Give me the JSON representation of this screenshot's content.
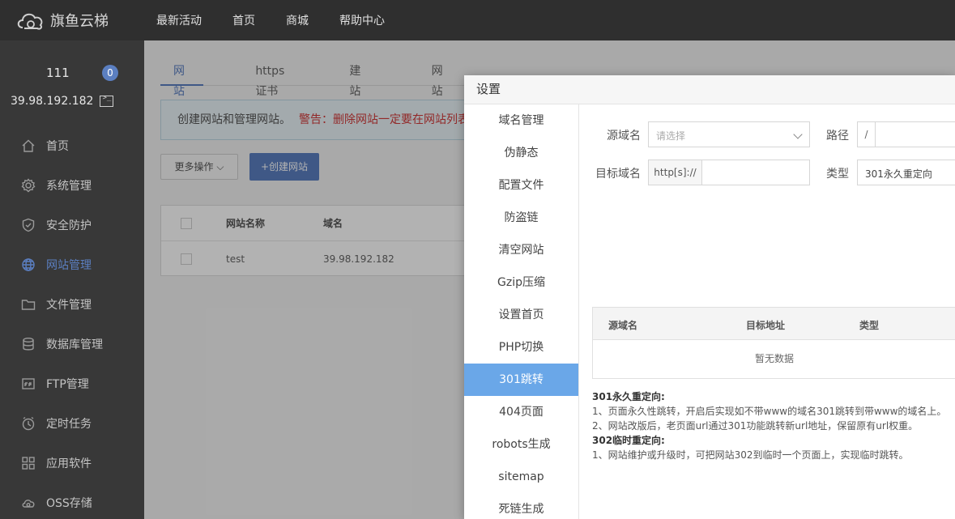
{
  "brand": {
    "name": "旗鱼云梯"
  },
  "topnav": [
    "最新活动",
    "首页",
    "商城",
    "帮助中心"
  ],
  "user": {
    "name": "111",
    "badge": "0",
    "ip": "39.98.192.182"
  },
  "sidebar": {
    "items": [
      {
        "label": "首页",
        "icon": "home-icon"
      },
      {
        "label": "系统管理",
        "icon": "gear-icon"
      },
      {
        "label": "安全防护",
        "icon": "shield-icon"
      },
      {
        "label": "网站管理",
        "icon": "globe-icon",
        "active": true
      },
      {
        "label": "文件管理",
        "icon": "folder-icon"
      },
      {
        "label": "数据库管理",
        "icon": "database-icon"
      },
      {
        "label": "FTP管理",
        "icon": "ftp-icon"
      },
      {
        "label": "定时任务",
        "icon": "clock-icon"
      },
      {
        "label": "应用软件",
        "icon": "apps-icon"
      },
      {
        "label": "OSS存储",
        "icon": "cloud-storage-icon"
      }
    ]
  },
  "main": {
    "tabs": [
      "网站列表",
      "https证书",
      "建站模板",
      "网站日志"
    ],
    "notice": "创建网站和管理网站。",
    "notice_warn": "警告：删除网站一定要在网站列表",
    "more_button": "更多操作 ⌵",
    "create_button": "+创建网站",
    "table": {
      "headers": [
        "网站名称",
        "域名"
      ],
      "rows": [
        [
          "test",
          "39.98.192.182"
        ]
      ]
    }
  },
  "dialog": {
    "title": "设置",
    "nav": [
      "域名管理",
      "伪静态",
      "配置文件",
      "防盗链",
      "清空网站",
      "Gzip压缩",
      "设置首页",
      "PHP切换",
      "301跳转",
      "404页面",
      "robots生成",
      "sitemap",
      "死链生成"
    ],
    "active_nav": "301跳转",
    "form": {
      "source_label": "源域名",
      "source_placeholder": "请选择",
      "path_label": "路径",
      "path_prefix": "/",
      "target_label": "目标域名",
      "target_prefix": "http[s]://",
      "type_label": "类型",
      "type_value": "301永久重定向"
    },
    "table": {
      "headers": [
        "源域名",
        "目标地址",
        "类型"
      ],
      "empty": "暂无数据"
    },
    "help": [
      {
        "text": "301永久重定向:",
        "heading": true
      },
      {
        "text": "1、页面永久性跳转，开启后实现如不带www的域名301跳转到带www的域名上。"
      },
      {
        "text": "2、网站改版后，老页面url通过301功能跳转新url地址，保留原有url权重。"
      },
      {
        "text": "302临时重定向:",
        "heading": true
      },
      {
        "text": "1、网站维护或升级时，可把网站302到临时一个页面上，实现临时跳转。"
      }
    ]
  }
}
